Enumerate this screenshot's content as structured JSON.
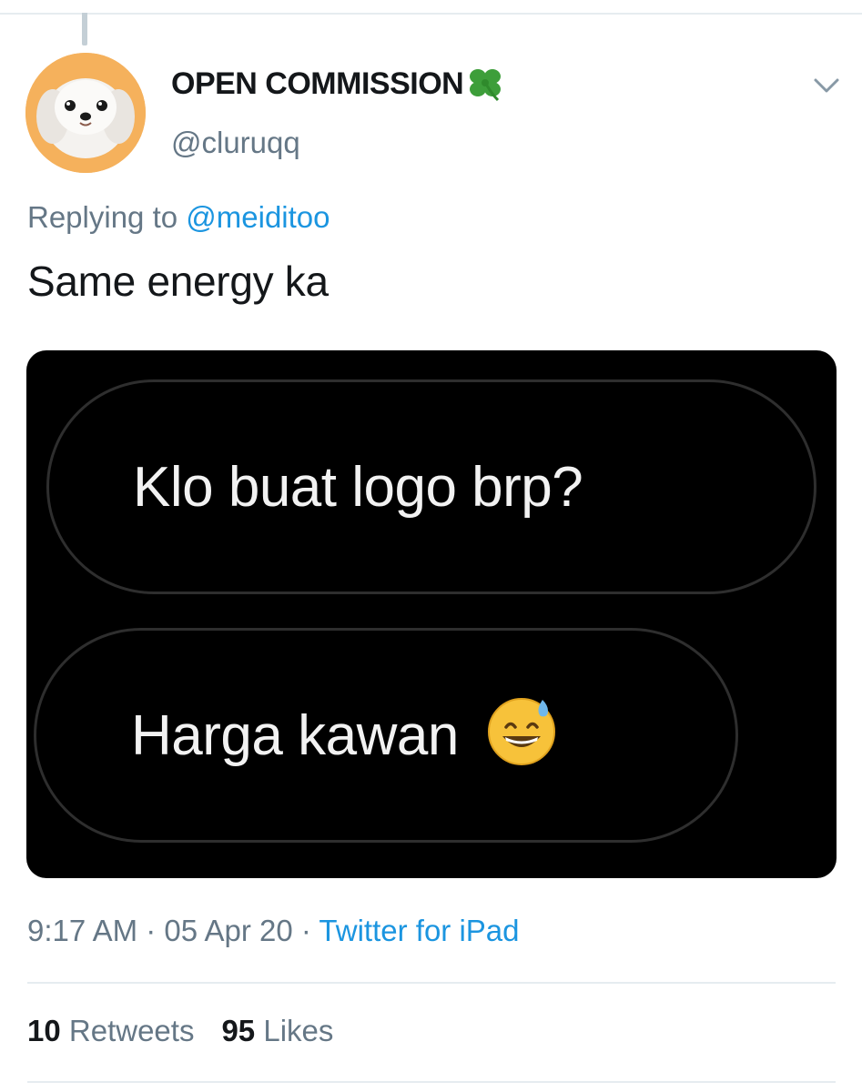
{
  "tweet": {
    "display_name": "OPEN COMMISSION",
    "name_emoji": "four-leaf-clover",
    "handle": "@cluruqq",
    "replying_prefix": "Replying to ",
    "replying_to": "@meiditoo",
    "text": "Same energy ka",
    "media": {
      "bubble_1": "Klo buat logo brp?",
      "bubble_2": "Harga kawan",
      "bubble_2_emoji": "grinning-face-with-sweat"
    },
    "time": "9:17 AM",
    "date": "05 Apr 20",
    "separator": " · ",
    "source": "Twitter for iPad",
    "retweets_count": "10",
    "retweets_label": "Retweets",
    "likes_count": "95",
    "likes_label": "Likes"
  },
  "colors": {
    "link": "#1b95e0",
    "secondary_text": "#657786",
    "primary_text": "#14171a",
    "avatar_bg": "#f5b15c"
  }
}
